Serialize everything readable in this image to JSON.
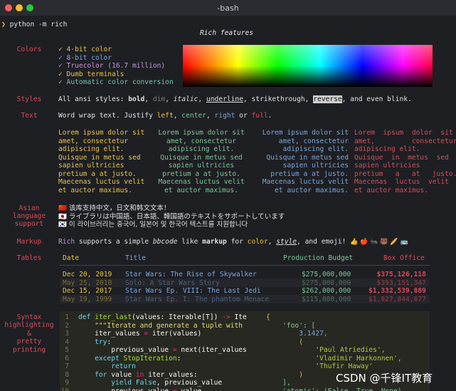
{
  "window": {
    "title": "-bash",
    "traffic": {
      "close": "#ff5f57",
      "minimize": "#febc2e",
      "maximize": "#28c840"
    }
  },
  "prompt": {
    "arrow": "❯",
    "command": "python -m rich"
  },
  "heading": "Rich features",
  "labels": {
    "colors": "Colors",
    "styles": "Styles",
    "text": "Text",
    "asian": [
      "Asian",
      "language",
      "support"
    ],
    "markup": "Markup",
    "tables": "Tables",
    "syntax": [
      "Syntax",
      "highlighting",
      "&",
      "pretty",
      "printing"
    ]
  },
  "colors": {
    "items": [
      {
        "text": "✓ 4-bit color",
        "color": "#e7c547"
      },
      {
        "text": "✓ 8-bit color",
        "color": "#7aa6da"
      },
      {
        "text": "✓ Truecolor (16.7 million)",
        "color": "#c397d8"
      },
      {
        "text": "✓ Dumb terminals",
        "color": "#e7c547"
      },
      {
        "text": "✓ Automatic color conversion",
        "color": "#70c0b1"
      }
    ]
  },
  "styles": {
    "prefix": "All ansi styles: ",
    "bold": "bold",
    "dim": "dim",
    "italic": "italic",
    "underline": "underline",
    "strike": "strikethrough",
    "reverse": "reverse",
    "suffix": ", and even blink."
  },
  "text": {
    "line": [
      "Word wrap text. Justify ",
      "left",
      ", ",
      "center",
      ", ",
      "right",
      " or ",
      "full",
      "."
    ],
    "lorem": [
      "Lorem ipsum dolor sit",
      "amet, consectetur",
      "adipiscing elit.",
      "Quisque in metus sed",
      "sapien ultricies",
      "pretium a at justo.",
      "Maecenas luctus velit",
      "et auctor maximus."
    ],
    "full": [
      "Lorem  ipsum  dolor  sit",
      "amet,         consectetur",
      "adipiscing elit.",
      "Quisque  in  metus  sed",
      "sapien ultricies",
      "pretium   a   at   justo.",
      "Maecenas  luctus  velit",
      "et auctor maximus."
    ]
  },
  "asian": [
    {
      "flag": "🇨🇳",
      "text": "该库支持中文，日文和韩文文本！"
    },
    {
      "flag": "🇯🇵",
      "text": "ライブラリは中国語、日本語、韓国語のテキストをサポートしています"
    },
    {
      "flag": "🇰🇷",
      "text": "이 라이브러리는 중국어, 일본어 및 한국어 텍스트를 지원합니다"
    }
  ],
  "markup": {
    "rich": "Rich",
    "t1": " supports a simple ",
    "bbcode": "bbcode",
    "t2": " like ",
    "mk": "markup",
    "t3": " for ",
    "color": "color",
    "t4": ", ",
    "style": "style",
    "t5": ", and emoji! ",
    "emoji": "👍 🍎 🐜 🐻 🥖 🚌"
  },
  "table": {
    "headers": [
      "Date",
      "Title",
      "Production Budget",
      "Box Office"
    ],
    "rows": [
      {
        "date": "Dec 20, 2019",
        "title": "Star Wars: The Rise of Skywalker",
        "budget": "$275,000,000",
        "box": "$375,126,118",
        "dim": false
      },
      {
        "date": "May 25, 2018",
        "title": "Solo: A Star Wars Story",
        "budget": "$275,000,000",
        "box": "$393,151,347",
        "dim": true
      },
      {
        "date": "Dec 15, 2017",
        "title": "Star Wars Ep. VIII: The Last Jedi",
        "budget": "$262,000,000",
        "box": "$1,332,539,889",
        "dim": false
      },
      {
        "date": "May 19, 1999",
        "title": "Star Wars Ep. I: The phantom Menace",
        "budget": "$115,000,000",
        "box": "$1,027,044,677",
        "dim": true
      }
    ]
  },
  "code": {
    "lines": [
      {
        "n": "1",
        "segs": [
          [
            "def ",
            "#66d9ef"
          ],
          [
            "iter_last",
            "#a6e22e"
          ],
          [
            "(values: Iterable[T]) ",
            "#f8f8f2"
          ],
          [
            "->",
            "#f92672"
          ],
          [
            " Ite",
            "#f8f8f2"
          ]
        ]
      },
      {
        "n": "2",
        "segs": [
          [
            "    \"\"\"Iterate and generate a tuple with",
            "#e6db74"
          ]
        ]
      },
      {
        "n": "3",
        "segs": [
          [
            "    iter_values ",
            "#f8f8f2"
          ],
          [
            "=",
            "#f92672"
          ],
          [
            " iter(values)",
            "#f8f8f2"
          ]
        ]
      },
      {
        "n": "4",
        "segs": [
          [
            "    try",
            "#66d9ef"
          ],
          [
            ":",
            "#f8f8f2"
          ]
        ]
      },
      {
        "n": "5",
        "segs": [
          [
            "        previous_value ",
            "#f8f8f2"
          ],
          [
            "=",
            "#f92672"
          ],
          [
            " next(iter_values",
            "#f8f8f2"
          ]
        ]
      },
      {
        "n": "6",
        "segs": [
          [
            "    except ",
            "#66d9ef"
          ],
          [
            "StopIteration",
            "#a6e22e"
          ],
          [
            ":",
            "#f8f8f2"
          ]
        ]
      },
      {
        "n": "7",
        "segs": [
          [
            "        return",
            "#66d9ef"
          ]
        ]
      },
      {
        "n": "8",
        "segs": [
          [
            "    for ",
            "#66d9ef"
          ],
          [
            "value ",
            "#f8f8f2"
          ],
          [
            "in ",
            "#f92672"
          ],
          [
            "iter_values:",
            "#f8f8f2"
          ]
        ]
      },
      {
        "n": "9",
        "segs": [
          [
            "        yield ",
            "#66d9ef"
          ],
          [
            "False",
            "#66d9ef"
          ],
          [
            ", previous_value",
            "#f8f8f2"
          ]
        ]
      },
      {
        "n": "10",
        "segs": [
          [
            "        previous_value ",
            "#f8f8f2"
          ],
          [
            "=",
            "#f92672"
          ],
          [
            " value",
            "#f8f8f2"
          ]
        ]
      }
    ],
    "pretty": [
      {
        "text": "{",
        "color": "#e7c547"
      },
      {
        "text": "    'foo': [",
        "color": "#7ec699"
      },
      {
        "text": "        3.1427,",
        "color": "#7aa6da"
      },
      {
        "text": "        (",
        "color": "#e7c547"
      },
      {
        "text": "            'Paul Atriedies',",
        "color": "#b5cc3a"
      },
      {
        "text": "            'Vladimir Harkonnen',",
        "color": "#b5cc3a"
      },
      {
        "text": "            'Thufir Haway'",
        "color": "#b5cc3a"
      },
      {
        "text": "        )",
        "color": "#e7c547"
      },
      {
        "text": "    ],",
        "color": "#7ec699"
      },
      {
        "text": "    'atomic': (False, True, None)",
        "color": "#7ec699"
      }
    ]
  },
  "watermark": "CSDN @千锋IT教育"
}
